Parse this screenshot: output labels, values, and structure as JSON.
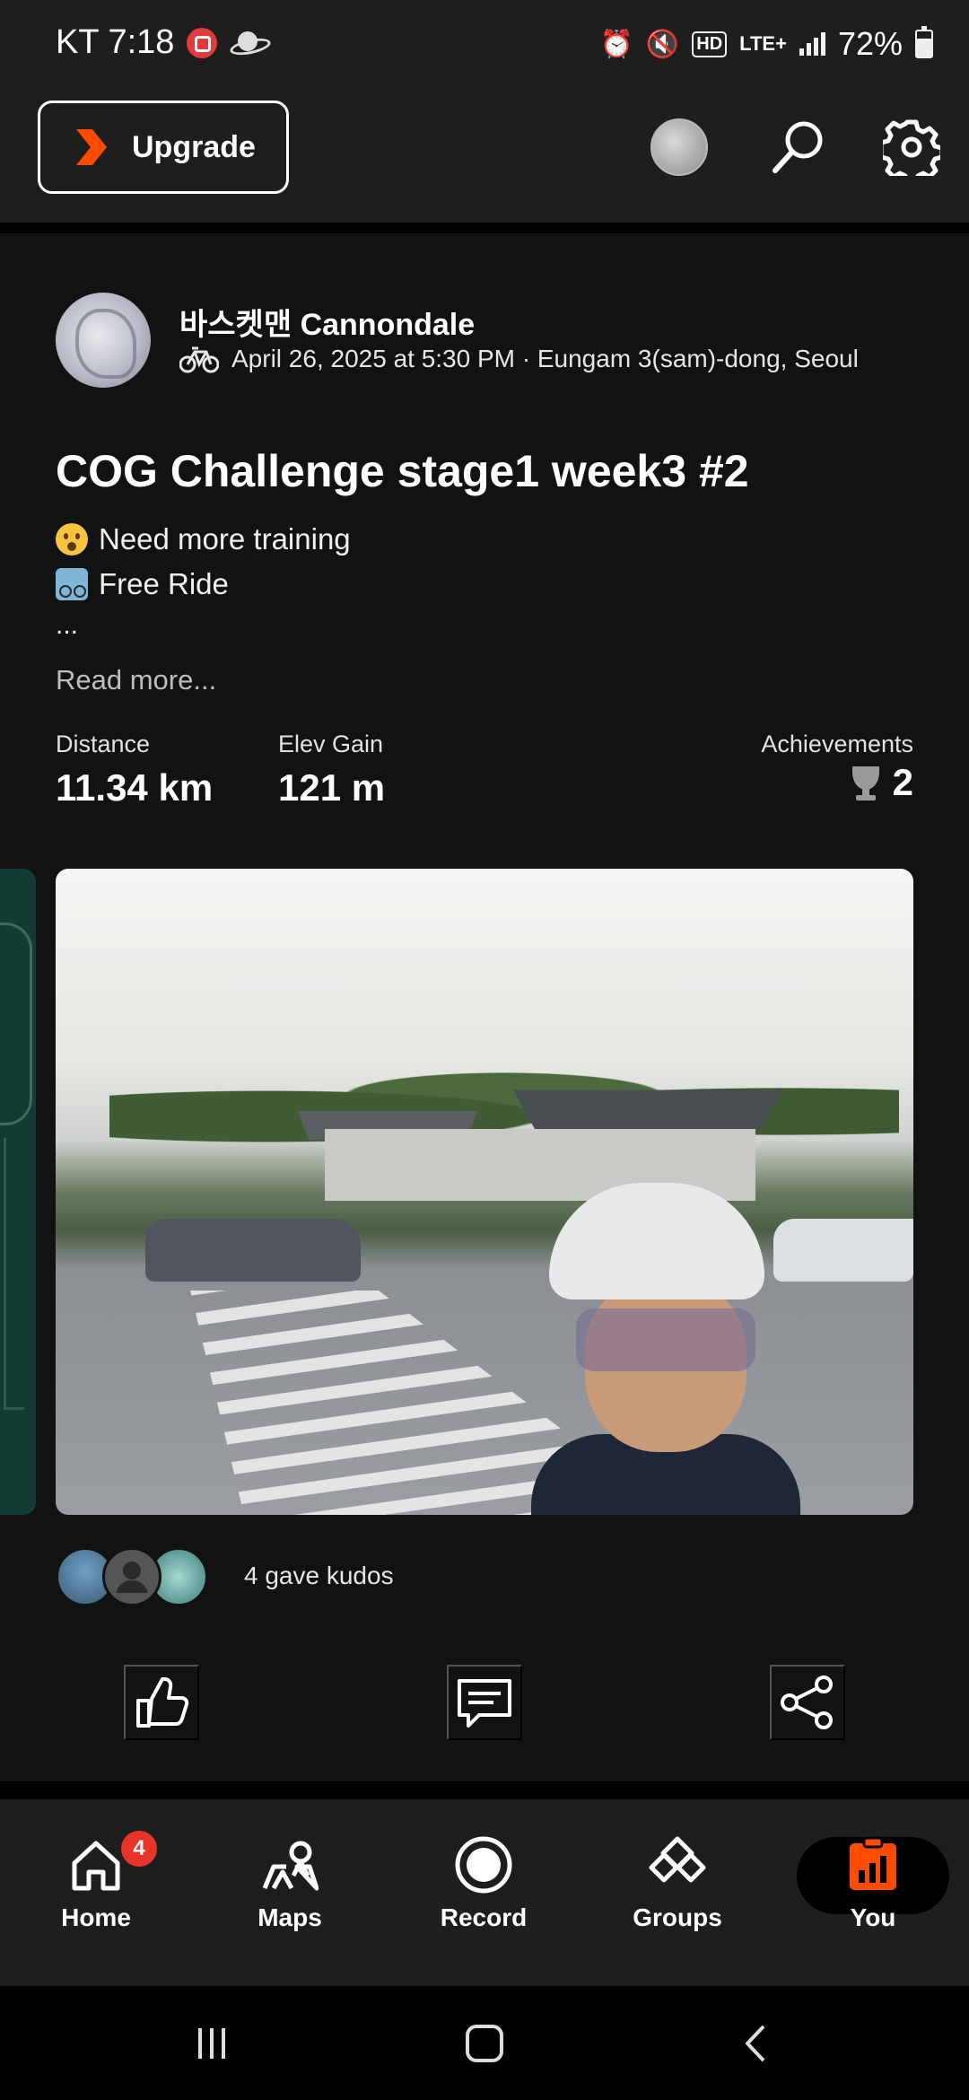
{
  "status_bar": {
    "carrier": "KT",
    "time": "7:18",
    "hd": "HD",
    "lte": "LTE+",
    "battery": "72%",
    "battery_level": 0.72
  },
  "top_bar": {
    "upgrade_label": "Upgrade",
    "accent_color": "#fc4c02"
  },
  "post": {
    "athlete_name": "바스켓맨 Cannondale",
    "meta": "April 26, 2025 at 5:30 PM · Eungam 3(sam)-dong, Seoul",
    "title": "COG Challenge stage1 week3 #2",
    "description": [
      {
        "emoji": "astonished-face",
        "text": "Need more training"
      },
      {
        "emoji": "person-biking",
        "text": "Free Ride"
      }
    ],
    "ellipsis": "...",
    "read_more": "Read more...",
    "stats": {
      "distance_label": "Distance",
      "distance_value": "11.34 km",
      "elev_label": "Elev Gain",
      "elev_value": "121 m",
      "achievements_label": "Achievements",
      "achievements_value": "2"
    },
    "kudos_text": "4 gave kudos"
  },
  "bottom_nav": {
    "items": [
      {
        "label": "Home",
        "icon": "home-icon",
        "badge": "4"
      },
      {
        "label": "Maps",
        "icon": "maps-icon"
      },
      {
        "label": "Record",
        "icon": "record-icon"
      },
      {
        "label": "Groups",
        "icon": "groups-icon"
      },
      {
        "label": "You",
        "icon": "you-icon",
        "active": true
      }
    ]
  }
}
